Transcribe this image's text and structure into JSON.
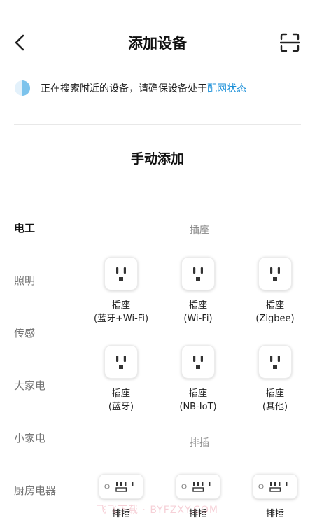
{
  "header": {
    "title": "添加设备",
    "back_icon": "chevron-left-icon",
    "scan_icon": "scan-icon"
  },
  "search": {
    "text": "正在搜索附近的设备，请确保设备处于",
    "link": "配网状态",
    "link_color": "#1a8fd8"
  },
  "manual": {
    "title": "手动添加"
  },
  "categories": [
    {
      "label": "电工",
      "active": true
    },
    {
      "label": "照明",
      "active": false
    },
    {
      "label": "传感",
      "active": false
    },
    {
      "label": "大家电",
      "active": false
    },
    {
      "label": "小家电",
      "active": false
    },
    {
      "label": "厨房电器",
      "active": false
    }
  ],
  "sections": [
    {
      "title": "插座",
      "items": [
        {
          "line1": "插座",
          "line2": "(蓝牙+Wi-Fi)",
          "icon": "socket-icon"
        },
        {
          "line1": "插座",
          "line2": "(Wi-Fi)",
          "icon": "socket-icon"
        },
        {
          "line1": "插座",
          "line2": "(Zigbee)",
          "icon": "socket-icon"
        },
        {
          "line1": "插座",
          "line2": "(蓝牙)",
          "icon": "socket-icon"
        },
        {
          "line1": "插座",
          "line2": "(NB-IoT)",
          "icon": "socket-icon"
        },
        {
          "line1": "插座",
          "line2": "(其他)",
          "icon": "socket-icon"
        }
      ]
    },
    {
      "title": "排插",
      "items": [
        {
          "line1": "排插",
          "icon": "power-strip-icon"
        },
        {
          "line1": "排插",
          "icon": "power-strip-icon"
        },
        {
          "line1": "排插",
          "icon": "power-strip-icon"
        }
      ]
    }
  ],
  "watermark": "飞飞下载 · BYFZXY.COM"
}
